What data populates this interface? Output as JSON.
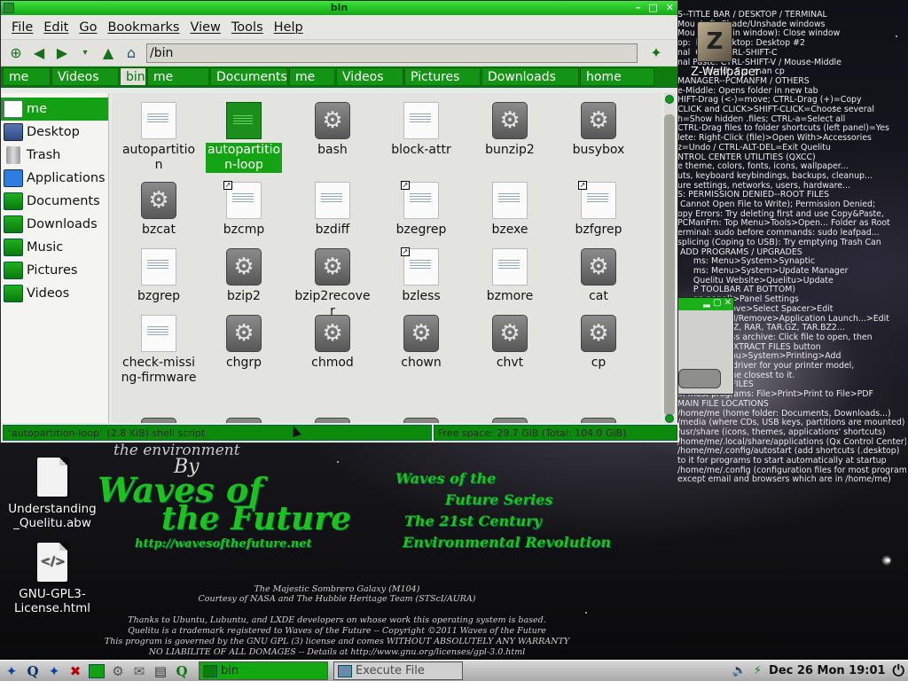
{
  "window": {
    "title": "bin",
    "controls": [
      "–",
      "□",
      "✕"
    ]
  },
  "menu": [
    "File",
    "Edit",
    "Go",
    "Bookmarks",
    "View",
    "Tools",
    "Help"
  ],
  "location": {
    "path": "/bin"
  },
  "breadcrumbs": [
    {
      "label": "me",
      "active": false
    },
    {
      "label": "Videos",
      "active": false
    },
    {
      "label": "bin",
      "active": true
    },
    {
      "label": "me",
      "active": false
    },
    {
      "label": "Documents",
      "active": false
    },
    {
      "label": "me",
      "active": false
    },
    {
      "label": "Videos",
      "active": false
    },
    {
      "label": "Pictures",
      "active": false
    },
    {
      "label": "Downloads",
      "active": false
    },
    {
      "label": "home",
      "active": false
    }
  ],
  "sidebar": [
    {
      "label": "me",
      "icon": "home-icon",
      "active": true
    },
    {
      "label": "Desktop",
      "icon": "desktop-icon",
      "active": false
    },
    {
      "label": "Trash",
      "icon": "trash-icon",
      "active": false
    },
    {
      "label": "Applications",
      "icon": "applications-icon",
      "active": false
    },
    {
      "label": "Documents",
      "icon": "folder-icon",
      "active": false
    },
    {
      "label": "Downloads",
      "icon": "folder-icon",
      "active": false
    },
    {
      "label": "Music",
      "icon": "folder-icon",
      "active": false
    },
    {
      "label": "Pictures",
      "icon": "folder-icon",
      "active": false
    },
    {
      "label": "Videos",
      "icon": "folder-icon",
      "active": false
    }
  ],
  "files": [
    {
      "name": "autopartition",
      "type": "doc",
      "link": false,
      "selected": false
    },
    {
      "name": "autopartition-loop",
      "type": "sel",
      "link": false,
      "selected": true
    },
    {
      "name": "bash",
      "type": "gear",
      "link": false,
      "selected": false
    },
    {
      "name": "block-attr",
      "type": "doc",
      "link": false,
      "selected": false
    },
    {
      "name": "bunzip2",
      "type": "gear",
      "link": false,
      "selected": false
    },
    {
      "name": "busybox",
      "type": "gear",
      "link": false,
      "selected": false
    },
    {
      "name": "bzcat",
      "type": "gear",
      "link": false,
      "selected": false
    },
    {
      "name": "bzcmp",
      "type": "doc",
      "link": true,
      "selected": false
    },
    {
      "name": "bzdiff",
      "type": "doc",
      "link": false,
      "selected": false
    },
    {
      "name": "bzegrep",
      "type": "doc",
      "link": true,
      "selected": false
    },
    {
      "name": "bzexe",
      "type": "doc",
      "link": false,
      "selected": false
    },
    {
      "name": "bzfgrep",
      "type": "doc",
      "link": true,
      "selected": false
    },
    {
      "name": "bzgrep",
      "type": "doc",
      "link": false,
      "selected": false
    },
    {
      "name": "bzip2",
      "type": "gear",
      "link": false,
      "selected": false
    },
    {
      "name": "bzip2recover",
      "type": "gear",
      "link": false,
      "selected": false
    },
    {
      "name": "bzless",
      "type": "doc",
      "link": true,
      "selected": false
    },
    {
      "name": "bzmore",
      "type": "doc",
      "link": false,
      "selected": false
    },
    {
      "name": "cat",
      "type": "gear",
      "link": false,
      "selected": false
    },
    {
      "name": "check-missing-firmware",
      "type": "doc",
      "link": false,
      "selected": false
    },
    {
      "name": "chgrp",
      "type": "gear",
      "link": false,
      "selected": false
    },
    {
      "name": "chmod",
      "type": "gear",
      "link": false,
      "selected": false
    },
    {
      "name": "chown",
      "type": "gear",
      "link": false,
      "selected": false
    },
    {
      "name": "chvt",
      "type": "gear",
      "link": false,
      "selected": false
    },
    {
      "name": "cp",
      "type": "gear",
      "link": false,
      "selected": false
    }
  ],
  "status": {
    "left": "\"autopartition-loop\" (2.8 KiB) shell script",
    "right": "Free space: 29.7 GiB (Total: 104.0 GiB)"
  },
  "desktop": {
    "wallpaper_launcher": "Z-Wallpaper",
    "icons": [
      {
        "label": "Understanding _Quelitu.abw",
        "icon": "document-icon"
      },
      {
        "label": "GNU-GPL3-License.html",
        "icon": "html-file-icon"
      }
    ],
    "tips": [
      "S--TITLE BAR / DESKTOP / TERMINAL",
      "Mou  Left: Shade/Unshade windows",
      "Mou  (or F12 in window): Close window",
      "op:  ll on Desktop: Desktop #2",
      "nal  Copy: CTRL-SHIFT-C",
      "nal Paste: CTRL-SHIFT-V / Mouse-Middle",
      "          mand'. E.g. man cp",
      "",
      "MANAGER--PCMANFM / OTHERS",
      "e-Middle: Opens folder in new tab",
      "HIFT-Drag (<-)=move; CTRL-Drag (+)=Copy",
      "CLICK and CLICK>SHIFT-CLICK=Choose several",
      "h=Show hidden .files; CTRL-a=Select all",
      "CTRL-Drag files to folder shortcuts (left panel)=Yes",
      "lete: Right-Click (file)>Open With>Accessories",
      "z=Undo / CTRL-ALT-DEL=Exit Quelitu",
      "",
      "NTROL CENTER UTILITIES (QXCC)",
      "e theme, colors, fonts, icons, wallpaper...",
      "uts, keyboard keybindings, backups, cleanup...",
      "ure settings, networks, users, hardware...",
      "",
      "S: PERMISSION DENIED--ROOT FILES",
      " Cannot Open File to Write); Permission Denied;",
      "opy Errors: Try deleting first and use Copy&Paste,",
      "PCManFm: Top Menu>Tools>Open... Folder as Root",
      "erminal: sudo before commands: sudo leafpad...",
      "splicing (Coping to USB): Try emptying Trash Can",
      "",
      " ADD PROGRAMS / UPGRADES",
      "      ms: Menu>System>Synaptic",
      "      ms: Menu>System>Update Manager",
      "      Quelitu Website>Quelitu>Update",
      "",
      "",
      "",
      "",
      "      P TOOLBAR AT BOTTOM)",
      "      on panel)>Panel Settings",
      "      Add/Remove>Select Spacer>Edit",
      "  ograms: Add/Remove>Application Launch...>Edit",
      "",
      "OLLER: ZIP, 7Z, RAR, TAR.GZ, TAR.BZ2...",
      "pack compress archive: Click file to open, then",
      "click on the EXTRACT FILES button",
      "",
      "",
      "PRINTER: Menu>System>Printing>Add",
      "If there is no driver for your printer model,",
      "choose the one closest to it.",
      "",
      "CREATE PDF FILES",
      "In most programs: File>Print>Print to File>PDF",
      "",
      "MAIN FILE LOCATIONS",
      "/home/me (home folder: Documents, Downloads...)",
      "/media (where CDs, USB keys, partitions are mounted)",
      "/usr/share (icons, themes, applications' shortcuts)",
      "/home/me/.local/share/applications (Qx Control Center)",
      "/home/me/.config/autostart (add shortcuts (.desktop)",
      "to it for programs to start automatically at startup",
      "/home/me/.config (configuration files for most programs",
      "except email and browsers which are in /home/me)"
    ],
    "art": {
      "env": "the environment",
      "by": "By",
      "waves1": "Waves of",
      "waves2": "the Future",
      "url": "http://wavesofthefuture.net",
      "series1": "Waves of the",
      "series2": "Future Series",
      "series3": "The 21st Century",
      "series4": "Environmental Revolution"
    },
    "credits": [
      "The Majestic Sombrero Galaxy (M104)",
      "Courtesy of NASA and The Hubble Heritage Team (STScI/AURA)",
      "",
      "Thanks to Ubuntu, Lubuntu, and LXDE developers on whose work this operating system is based.",
      "Quelitu is a trademark registered to Waves of the Future  --  Copyright ©2011  Waves of the Future",
      "This program is governed by the GNU GPL (3) license and comes WITHOUT ABSOLUTELY ANY WARRANTY",
      "     NO LIABILITE OF ALL DOMAGES -- Details at http://www.gnu.org/licenses/gpl-3.0.html"
    ]
  },
  "taskbar": {
    "tasks": [
      {
        "label": "bin",
        "active": true
      },
      {
        "label": "Execute File",
        "active": false
      }
    ],
    "clock": "Dec 26 Mon 19:01"
  },
  "colors": {
    "accent": "#12a812",
    "selection": "#13a413"
  }
}
